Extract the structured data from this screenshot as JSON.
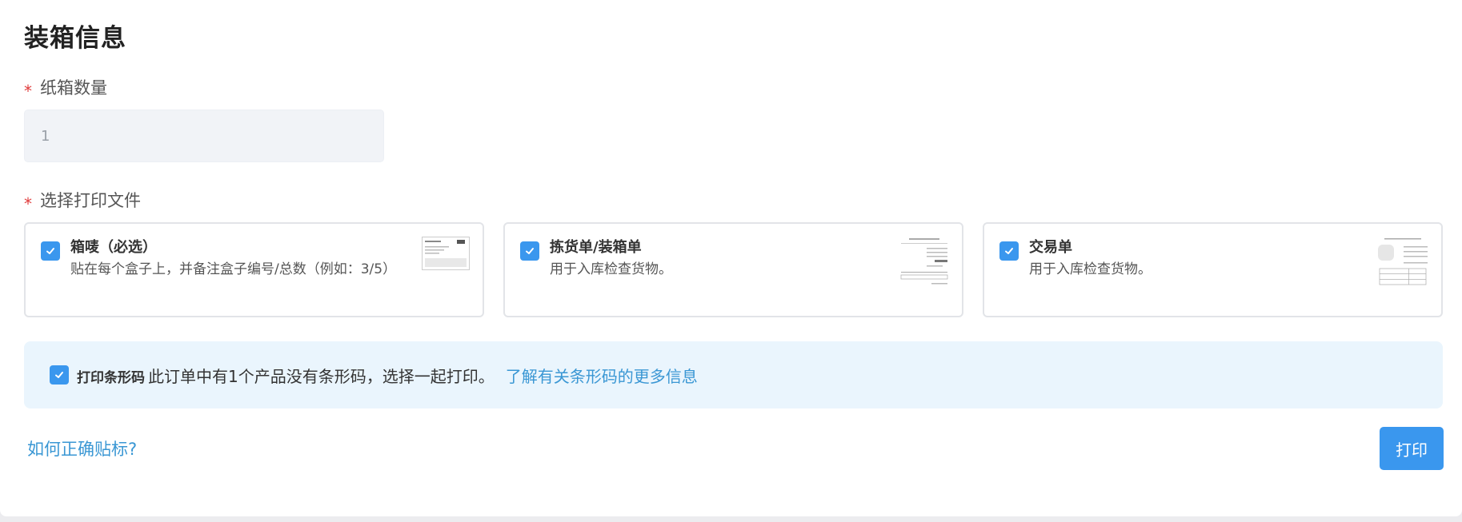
{
  "page": {
    "title": "装箱信息"
  },
  "carton_qty": {
    "required_mark": "*",
    "label": "纸箱数量",
    "value": "1"
  },
  "print_files": {
    "required_mark": "*",
    "label": "选择打印文件",
    "options": [
      {
        "title": "箱唛（必选）",
        "desc": "贴在每个盒子上，并备注盒子编号/总数（例如：3/5）",
        "checked": true
      },
      {
        "title": "拣货单/装箱单",
        "desc": "用于入库检查货物。",
        "checked": true
      },
      {
        "title": "交易单",
        "desc": "用于入库检查货物。",
        "checked": true
      }
    ]
  },
  "barcode": {
    "checked": true,
    "label": "打印条形码",
    "text": "此订单中有1个产品没有条形码，选择一起打印。",
    "link": "了解有关条形码的更多信息"
  },
  "footer": {
    "help_link": "如何正确贴标?",
    "print_button": "打印"
  },
  "colors": {
    "accent": "#3a97ee",
    "link": "#3a97d4",
    "required": "#e03b3b",
    "info_bg": "#eaf5fd"
  },
  "icons": {
    "checkbox": "check-icon"
  }
}
